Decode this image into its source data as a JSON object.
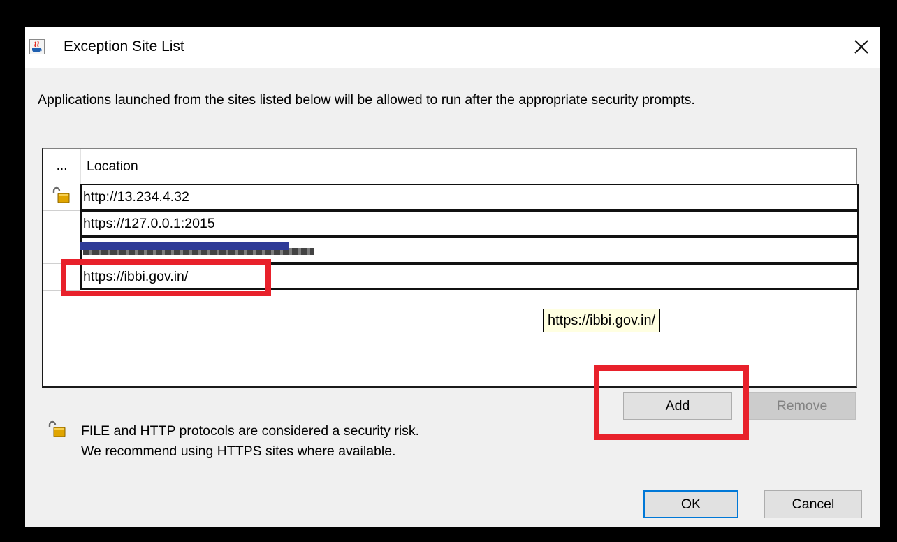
{
  "window": {
    "title": "Exception Site List",
    "close_glyph": "✕"
  },
  "description": "Applications launched from the sites listed below will be allowed to run after the appropriate security prompts.",
  "table": {
    "columns": [
      "...",
      "Location"
    ],
    "rows": [
      {
        "location": "http://13.234.4.32",
        "insecure": true
      },
      {
        "location": "https://127.0.0.1:2015",
        "insecure": false
      },
      {
        "location": "https://...",
        "insecure": false
      },
      {
        "location": "https://ibbi.gov.in/",
        "insecure": false
      }
    ]
  },
  "tooltip": "https://ibbi.gov.in/",
  "buttons": {
    "add": "Add",
    "remove": "Remove",
    "ok": "OK",
    "cancel": "Cancel"
  },
  "warning": {
    "line1": "FILE and HTTP protocols are considered a security risk.",
    "line2": "We recommend using HTTPS sites where available."
  },
  "colors": {
    "highlight": "#e8212b",
    "default_button_border": "#0078d7",
    "tooltip_bg": "#ffffe1",
    "redaction": "#2f3b97"
  },
  "icons": {
    "title": "java-icon",
    "close": "close-icon",
    "insecure": "unlocked-padlock-icon"
  }
}
